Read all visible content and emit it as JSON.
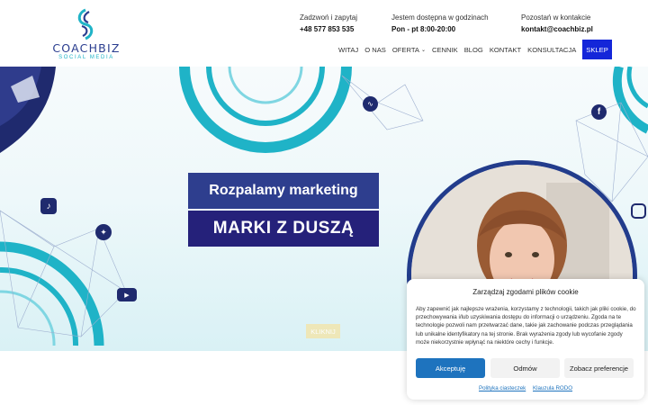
{
  "brand": {
    "name": "COACHBIZ",
    "tagline": "SOCIAL MEDIA"
  },
  "contacts": [
    {
      "label": "Zadzwoń i zapytaj",
      "value": "+48 577 853 535"
    },
    {
      "label": "Jestem dostępna w godzinach",
      "value": "Pon - pt 8:00-20:00"
    },
    {
      "label": "Pozostań w kontakcie",
      "value": "kontakt@coachbiz.pl"
    }
  ],
  "nav": {
    "items": [
      "WITAJ",
      "O NAS",
      "OFERTA",
      "CENNIK",
      "BLOG",
      "KONTAKT",
      "KONSULTACJA"
    ],
    "shop": "SKLEP",
    "dropdown_icon": "chevron-down-icon"
  },
  "hero": {
    "headline_top": "Rozpalamy marketing",
    "headline_bottom": "MARKI Z DUSZĄ",
    "link_label": "KLIKNIJ",
    "social_icons": [
      "tiktok-icon",
      "twitter-icon",
      "youtube-icon",
      "facebook-icon",
      "instagram-icon"
    ],
    "colors": {
      "accent": "#1fb3c7",
      "navy": "#25217a",
      "banner": "#2e3e8e"
    }
  },
  "cookie": {
    "title": "Zarządzaj zgodami plików cookie",
    "text": "Aby zapewnić jak najlepsze wrażenia, korzystamy z technologii, takich jak pliki cookie, do przechowywania i/lub uzyskiwania dostępu do informacji o urządzeniu. Zgoda na te technologie pozwoli nam przetwarzać dane, takie jak zachowanie podczas przeglądania lub unikalne identyfikatory na tej stronie. Brak wyrażenia zgody lub wycofanie zgody może niekorzystnie wpłynąć na niektóre cechy i funkcje.",
    "accept": "Akceptuję",
    "deny": "Odmów",
    "preferences": "Zobacz preferencje",
    "link_cookies": "Polityka ciasteczek",
    "link_rodo": "Klauzula RODO",
    "accent_color": "#1e73be"
  }
}
